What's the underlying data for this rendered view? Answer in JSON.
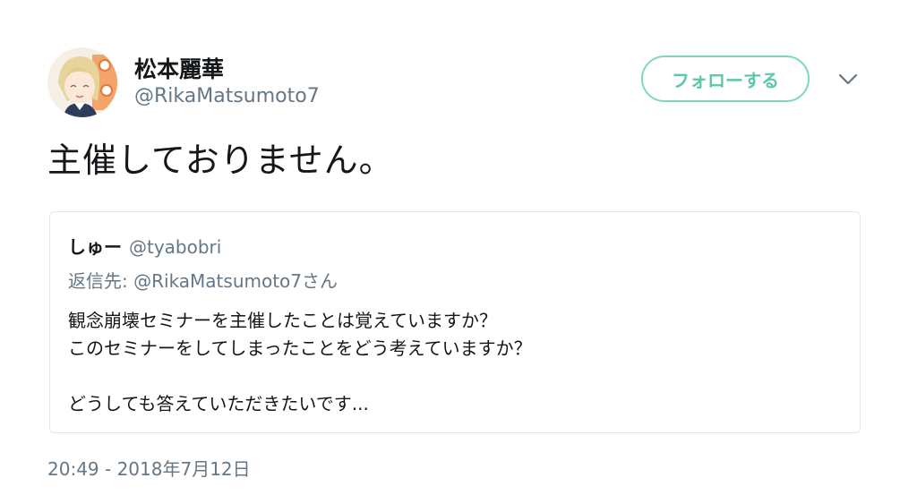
{
  "tweet": {
    "author": {
      "display_name": "松本麗華",
      "handle": "@RikaMatsumoto7"
    },
    "follow_label": "フォローする",
    "text": "主催しておりません。",
    "timestamp": "20:49 - 2018年7月12日"
  },
  "quote": {
    "name": "しゅー",
    "handle": "@tyabobri",
    "reply_prefix": "返信先: ",
    "reply_mention": "@RikaMatsumoto7",
    "reply_suffix": "さん",
    "lines": [
      "観念崩壊セミナーを主催したことは覚えていますか？",
      "このセミナーをしてしまったことをどう考えていますか？",
      "",
      "どうしても答えていただきたいです..."
    ]
  },
  "colors": {
    "accent": "#5cc7aa",
    "follow_border": "#7ed6c0",
    "secondary_text": "#657786",
    "primary_text": "#14171a",
    "card_border": "#e1e8ed"
  },
  "icons": {
    "menu": "chevron-down-icon",
    "avatar": "profile-avatar"
  }
}
